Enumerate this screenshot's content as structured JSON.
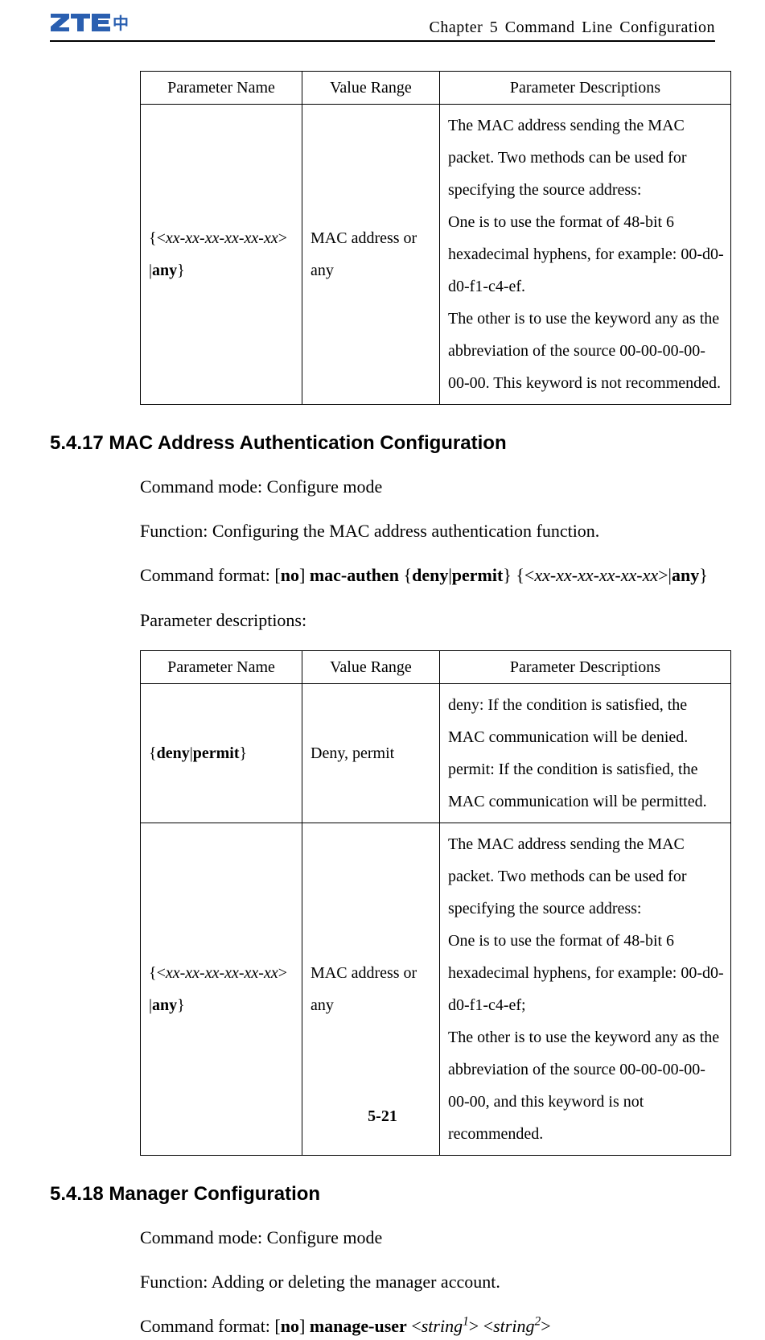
{
  "header": {
    "chapter": "Chapter 5 Command Line Configuration"
  },
  "table1": {
    "headers": [
      "Parameter Name",
      "Value Range",
      "Parameter Descriptions"
    ],
    "rows": [
      {
        "param_open": "{<",
        "param_mac": "xx-xx-xx-xx-xx-xx",
        "param_mid": "> |",
        "param_any": "any",
        "param_close": "}",
        "value": "MAC address or any",
        "desc_p1": "The MAC address sending the MAC packet. Two methods can be used for specifying the source address:",
        "desc_p2": "One is to use the format of 48-bit 6 hexadecimal hyphens, for example: 00-d0-d0-f1-c4-ef.",
        "desc_p3": "The other is to use the keyword any as the abbreviation of the source 00-00-00-00-00-00. This keyword is not recommended."
      }
    ]
  },
  "section17": {
    "heading": "5.4.17 MAC Address Authentication Configuration",
    "p1": "Command mode: Configure mode",
    "p2": "Function: Configuring the MAC address authentication function.",
    "p3_label": "Command format: [",
    "p3_no": "no",
    "p3_a": "] ",
    "p3_mac": "mac-authen",
    "p3_sp": " {",
    "p3_deny": "deny",
    "p3_pipe": "|",
    "p3_permit": "permit",
    "p3_b": "} {<",
    "p3_xx": "xx-xx-xx-xx-xx-xx",
    "p3_c": ">|",
    "p3_any": "any",
    "p3_d": "}",
    "p4": "Parameter descriptions:"
  },
  "table2": {
    "headers": [
      "Parameter Name",
      "Value Range",
      "Parameter Descriptions"
    ],
    "rows": [
      {
        "param_open": "{",
        "param_deny": "deny",
        "param_pipe": "|",
        "param_permit": "permit",
        "param_close": "}",
        "value": "Deny, permit",
        "desc_p1": "deny: If the condition is satisfied, the MAC communication will be denied.",
        "desc_p2": "permit: If the condition is satisfied, the MAC communication will be permitted."
      },
      {
        "param_open": "{<",
        "param_mac": "xx-xx-xx-xx-xx-xx",
        "param_mid": "> |",
        "param_any": "any",
        "param_close": "}",
        "value": "MAC address or any",
        "desc_p1": "The MAC address sending the MAC packet. Two methods can be used for specifying the source address:",
        "desc_p2": "One is to use the format of 48-bit 6 hexadecimal hyphens, for example: 00-d0-d0-f1-c4-ef;",
        "desc_p3": "The other is to use the keyword any as the abbreviation of the source 00-00-00-00-00-00, and this keyword is not recommended."
      }
    ]
  },
  "section18": {
    "heading": "5.4.18 Manager Configuration",
    "p1": "Command mode: Configure mode",
    "p2": "Function: Adding or deleting the manager account.",
    "p3_label": "Command format: [",
    "p3_no": "no",
    "p3_a": "] ",
    "p3_manage": "manage-user",
    "p3_b": " <",
    "p3_s1": "string",
    "p3_sup1": "1",
    "p3_c": "> <",
    "p3_s2": "string",
    "p3_sup2": "2",
    "p3_d": ">"
  },
  "footer": {
    "page": "5-21"
  }
}
